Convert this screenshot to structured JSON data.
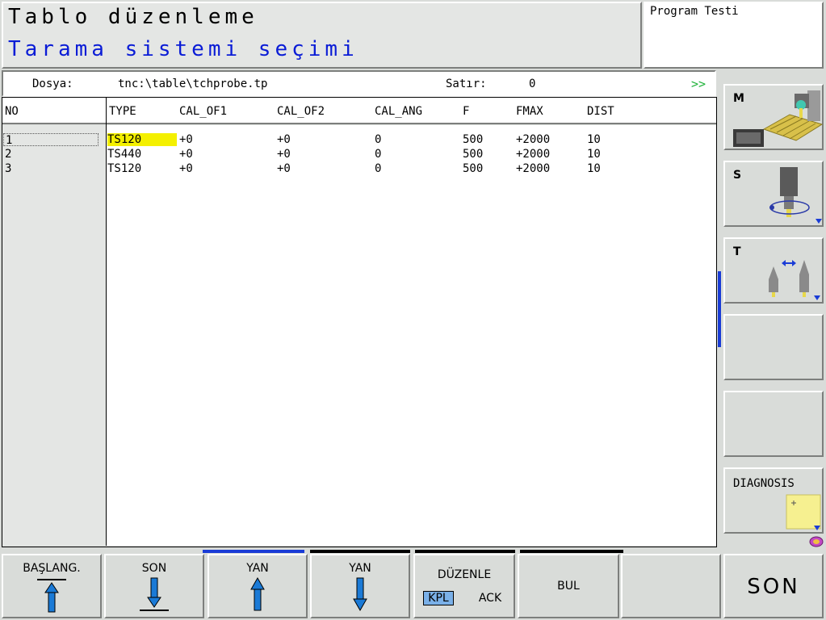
{
  "header": {
    "line1": "Tablo düzenleme",
    "line2": "Tarama sistemi seçimi",
    "mode": "Program Testi"
  },
  "filebar": {
    "file_label": "Dosya:",
    "file_path": "tnc:\\table\\tchprobe.tp",
    "row_label": "Satır:",
    "row_value": "0",
    "more": ">>"
  },
  "table": {
    "columns": [
      "NO",
      "TYPE",
      "CAL_OF1",
      "CAL_OF2",
      "CAL_ANG",
      "F",
      "FMAX",
      "DIST"
    ],
    "rows": [
      {
        "no": "1",
        "type": "TS120",
        "cal_of1": "+0",
        "cal_of2": "+0",
        "cal_ang": "0",
        "f": "500",
        "fmax": "+2000",
        "dist": "10"
      },
      {
        "no": "2",
        "type": "TS440",
        "cal_of1": "+0",
        "cal_of2": "+0",
        "cal_ang": "0",
        "f": "500",
        "fmax": "+2000",
        "dist": "10"
      },
      {
        "no": "3",
        "type": "TS120",
        "cal_of1": "+0",
        "cal_of2": "+0",
        "cal_ang": "0",
        "f": "500",
        "fmax": "+2000",
        "dist": "10"
      }
    ]
  },
  "side": {
    "m_label": "M",
    "s_label": "S",
    "t_label": "T",
    "diagnosis_label": "DIAGNOSIS"
  },
  "softkeys": {
    "start": "BAŞLANG.",
    "end": "SON",
    "page_up": "YAN",
    "page_down": "YAN",
    "edit": "DÜZENLE",
    "edit_off": "KPL",
    "edit_on": "ACK",
    "find": "BUL",
    "exit": "SON"
  },
  "colors": {
    "highlight": "#f4f000",
    "accent_blue": "#0a1cd6",
    "green_more": "#22b33c"
  }
}
